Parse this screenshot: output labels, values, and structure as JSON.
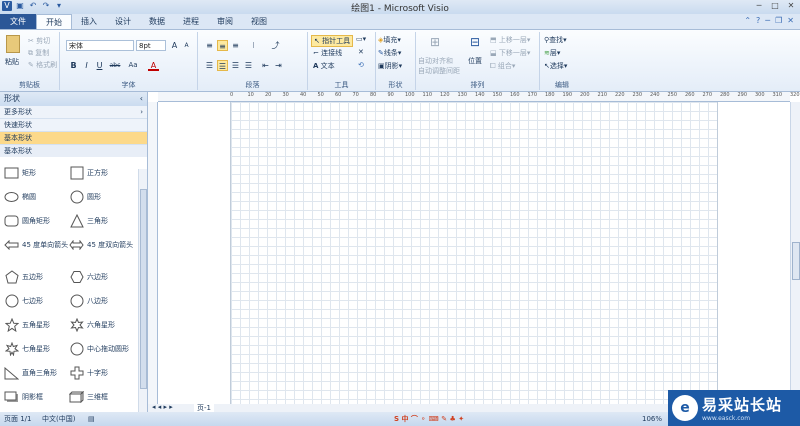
{
  "window": {
    "title": "绘图1 - Microsoft Visio",
    "qat_icons": [
      "visio-icon",
      "save-icon",
      "undo-icon",
      "redo-icon",
      "customize-icon"
    ]
  },
  "tabs": [
    {
      "label": "文件"
    },
    {
      "label": "开始"
    },
    {
      "label": "插入"
    },
    {
      "label": "设计"
    },
    {
      "label": "数据"
    },
    {
      "label": "进程"
    },
    {
      "label": "审阅"
    },
    {
      "label": "视图"
    }
  ],
  "ribbon": {
    "clipboard": {
      "label": "剪贴板",
      "paste": "粘贴",
      "cut": "剪切",
      "copy": "复制",
      "format_painter": "格式刷"
    },
    "font": {
      "label": "字体",
      "family": "宋体",
      "size": "8pt",
      "bold": "B",
      "italic": "I",
      "underline": "U",
      "strike": "abc",
      "case": "Aa",
      "grow": "A",
      "shrink": "A"
    },
    "paragraph": {
      "label": "段落"
    },
    "tools": {
      "label": "工具",
      "pointer": "指针工具",
      "connector": "连接线",
      "text": "文本"
    },
    "shape": {
      "label": "形状",
      "fill": "填充",
      "line": "线条",
      "shadow": "阴影"
    },
    "arrange": {
      "label": "排列",
      "auto_align": "自动对齐和",
      "auto_space": "自动调整间距",
      "position": "位置",
      "bring_forward": "上移一层",
      "send_backward": "下移一层",
      "group": "组合"
    },
    "editing": {
      "label": "编辑",
      "find": "查找",
      "layers": "层",
      "select": "选择"
    }
  },
  "shapes_pane": {
    "title": "形状",
    "more_shapes": "更多形状",
    "quick_shapes": "快速形状",
    "basic_shapes": "基本形状",
    "stencil_title": "基本形状",
    "items": [
      {
        "label": "矩形",
        "icon": "rectangle-icon"
      },
      {
        "label": "正方形",
        "icon": "square-icon"
      },
      {
        "label": "椭圆",
        "icon": "ellipse-icon"
      },
      {
        "label": "圆形",
        "icon": "circle-icon"
      },
      {
        "label": "圆角矩形",
        "icon": "rounded-rectangle-icon"
      },
      {
        "label": "三角形",
        "icon": "triangle-icon"
      },
      {
        "label": "45 度单向箭头",
        "icon": "single-arrow-icon"
      },
      {
        "label": "45 度双向箭头",
        "icon": "double-arrow-icon"
      },
      {
        "label": "五边形",
        "icon": "pentagon-icon"
      },
      {
        "label": "六边形",
        "icon": "hexagon-icon"
      },
      {
        "label": "七边形",
        "icon": "heptagon-icon"
      },
      {
        "label": "八边形",
        "icon": "octagon-icon"
      },
      {
        "label": "五角星形",
        "icon": "five-point-star-icon"
      },
      {
        "label": "六角星形",
        "icon": "six-point-star-icon"
      },
      {
        "label": "七角星形",
        "icon": "seven-point-star-icon"
      },
      {
        "label": "中心拖动圆形",
        "icon": "center-drag-circle-icon"
      },
      {
        "label": "直角三角形",
        "icon": "right-triangle-icon"
      },
      {
        "label": "十字形",
        "icon": "cross-icon"
      },
      {
        "label": "阴影框",
        "icon": "shadow-box-icon"
      },
      {
        "label": "三维框",
        "icon": "3d-box-icon"
      }
    ]
  },
  "ruler": {
    "ticks": [
      "0",
      "10",
      "20",
      "30",
      "40",
      "50",
      "60",
      "70",
      "80",
      "90",
      "100",
      "110",
      "120",
      "130",
      "140",
      "150",
      "160",
      "170",
      "180",
      "190",
      "200",
      "210",
      "220",
      "230",
      "240",
      "250",
      "260",
      "270",
      "280",
      "290",
      "300",
      "310",
      "320"
    ]
  },
  "page_tabs": {
    "current": "页-1"
  },
  "status": {
    "page": "页面 1/1",
    "language": "中文(中国)",
    "zoom": "106%"
  },
  "watermark": {
    "title": "易采站长站",
    "url": "www.easck.com"
  }
}
